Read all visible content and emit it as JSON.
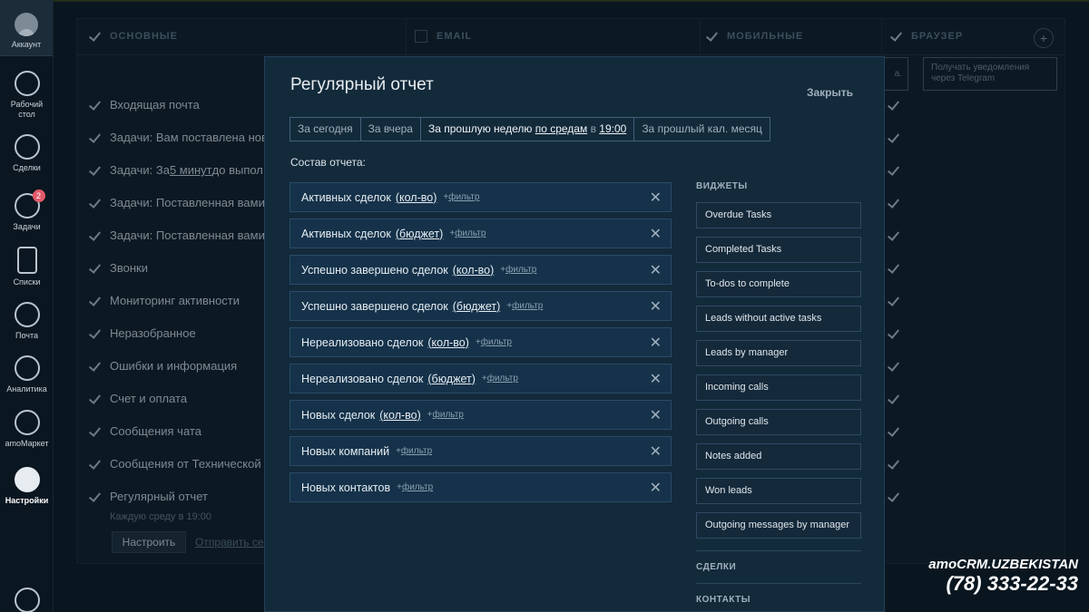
{
  "sidebar": {
    "account": "Аккаунт",
    "items": [
      {
        "label": "Рабочий\nстол",
        "icon": "dashboard-icon"
      },
      {
        "label": "Сделки",
        "icon": "dollar-icon"
      },
      {
        "label": "Задачи",
        "icon": "check-icon",
        "badge": "2"
      },
      {
        "label": "Списки",
        "icon": "list-icon"
      },
      {
        "label": "Почта",
        "icon": "mail-icon"
      },
      {
        "label": "Аналитика",
        "icon": "analytics-icon"
      },
      {
        "label": "amoМаркет",
        "icon": "market-icon"
      },
      {
        "label": "Настройки",
        "icon": "wrench-icon"
      }
    ]
  },
  "settings": {
    "columns": [
      "ОСНОВНЫЕ",
      "EMAIL",
      "МОБИЛЬНЫЕ",
      "БРАУЗЕР"
    ],
    "telegram_hint": "Получать уведомления через Telegram",
    "box_suffix": "а.",
    "rows": [
      {
        "pre": "Входящая почта",
        "u": "",
        "post": ""
      },
      {
        "pre": "Задачи: Вам поставлена нова",
        "u": "",
        "post": ""
      },
      {
        "pre": "Задачи: За ",
        "u": "5 минут",
        "post": " до выпол"
      },
      {
        "pre": "Задачи: Поставленная вами з",
        "u": "",
        "post": ""
      },
      {
        "pre": "Задачи: Поставленная вами з",
        "u": "",
        "post": ""
      },
      {
        "pre": "Звонки",
        "u": "",
        "post": ""
      },
      {
        "pre": "Мониторинг активности",
        "u": "",
        "post": ""
      },
      {
        "pre": "Неразобранное",
        "u": "",
        "post": ""
      },
      {
        "pre": "Ошибки и информация",
        "u": "",
        "post": ""
      },
      {
        "pre": "Счет и оплата",
        "u": "",
        "post": ""
      },
      {
        "pre": "Сообщения чата",
        "u": "",
        "post": ""
      },
      {
        "pre": "Сообщения от Технической п",
        "u": "",
        "post": ""
      },
      {
        "pre": "Регулярный отчет",
        "u": "",
        "post": ""
      }
    ],
    "report_note": "Каждую среду в 19:00",
    "setup_button": "Настроить",
    "send_link": "Отправить сей"
  },
  "modal": {
    "title": "Регулярный отчет",
    "close": "Закрыть",
    "periods": {
      "today": "За сегодня",
      "yesterday": "За вчера",
      "week_pre": "За прошлую неделю",
      "week_day": "по средам",
      "week_in": "в",
      "week_time": "19:00",
      "month": "За прошлый кал. месяц"
    },
    "composition_label": "Состав отчета:",
    "filter_label": "фильтр",
    "report_items": [
      {
        "label": "Активных сделок",
        "unit": "(кол-во)"
      },
      {
        "label": "Активных сделок",
        "unit": "(бюджет)"
      },
      {
        "label": "Успешно завершено сделок",
        "unit": "(кол-во)"
      },
      {
        "label": "Успешно завершено сделок",
        "unit": "(бюджет)"
      },
      {
        "label": "Нереализовано сделок",
        "unit": "(кол-во)"
      },
      {
        "label": "Нереализовано сделок",
        "unit": "(бюджет)"
      },
      {
        "label": "Новых сделок",
        "unit": "(кол-во)"
      },
      {
        "label": "Новых компаний",
        "unit": ""
      },
      {
        "label": "Новых контактов",
        "unit": ""
      }
    ],
    "widgets_head": "ВИДЖЕТЫ",
    "widgets": [
      "Overdue Tasks",
      "Completed Tasks",
      "To-dos to complete",
      "Leads without active tasks",
      "Leads by manager",
      "Incoming calls",
      "Outgoing calls",
      "Notes added",
      "Won leads",
      "Outgoing messages by manager"
    ],
    "deals_head": "СДЕЛКИ",
    "contacts_head": "КОНТАКТЫ"
  },
  "brand": {
    "line1": "amoCRM.UZBEKISTAN",
    "line2": "(78) 333-22-33"
  }
}
